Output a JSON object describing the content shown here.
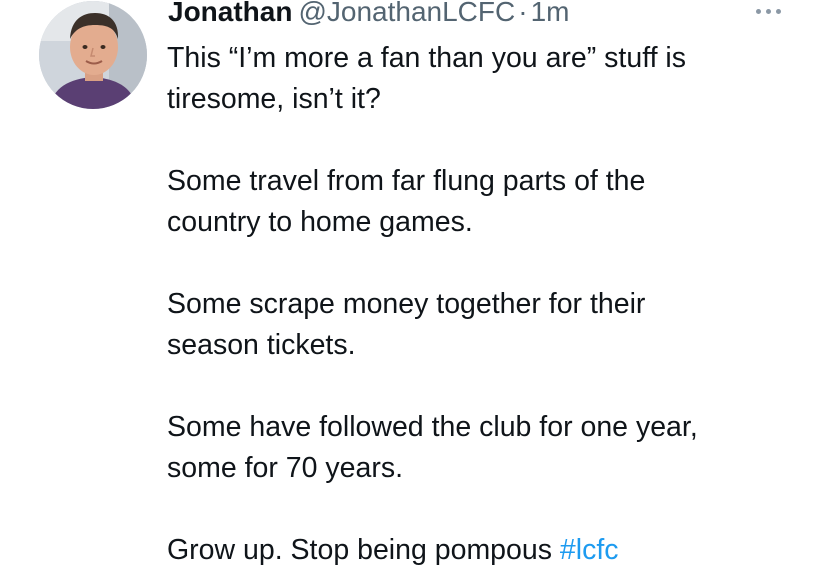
{
  "tweet": {
    "author": {
      "display_name": "Jonathan",
      "handle": "@JonathanLCFC",
      "avatar_icon": "profile-photo"
    },
    "separator": "·",
    "time": "1m",
    "more_icon": "more-horizontal-icon",
    "paragraphs": [
      {
        "line1": "This “I’m more a fan than you are” stuff is",
        "line2": "tiresome, isn’t it?"
      },
      {
        "line1": "Some travel from far flung parts of the",
        "line2": "country to home games."
      },
      {
        "line1": "Some scrape money together for their",
        "line2": "season tickets."
      },
      {
        "line1": "Some have followed the club for one year,",
        "line2": "some for 70 years."
      },
      {
        "text": "Grow up. Stop being pompous",
        "hashtag": "#lcfc"
      }
    ]
  },
  "colors": {
    "text": "#0f1419",
    "secondary": "#536471",
    "link": "#1d9bf0",
    "background": "#ffffff"
  }
}
